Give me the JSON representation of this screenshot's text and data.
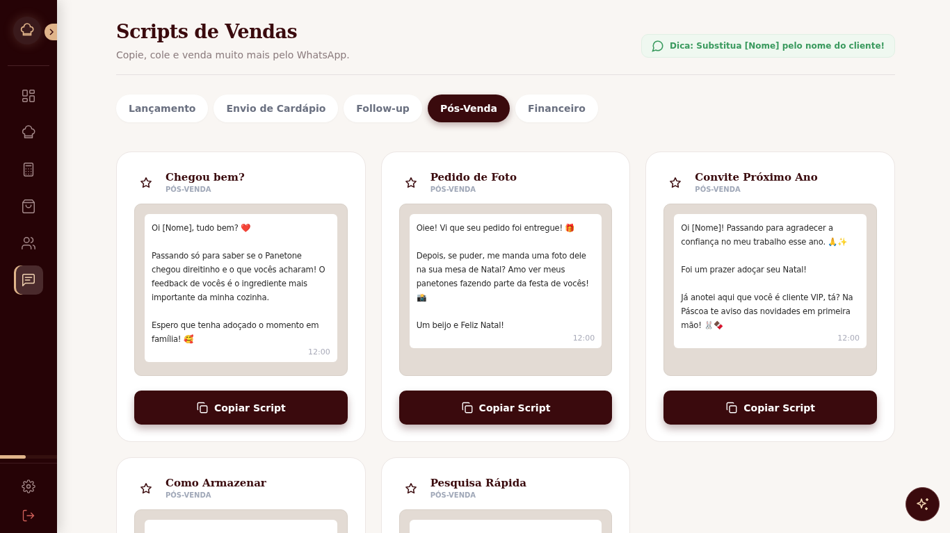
{
  "sidebar": {
    "items": [
      {
        "kind": "dashboard",
        "selected": false
      },
      {
        "kind": "chef",
        "selected": false
      },
      {
        "kind": "calculator",
        "selected": false
      },
      {
        "kind": "bag",
        "selected": false
      },
      {
        "kind": "users",
        "selected": false
      },
      {
        "kind": "chat",
        "selected": true
      }
    ],
    "progress": {
      "level": 0.45
    }
  },
  "header": {
    "title": "Scripts de Vendas",
    "subtitle": "Copie, cole e venda muito mais pelo WhatsApp.",
    "tip": "Dica: Substitua [Nome] pelo nome do cliente!"
  },
  "tabs": [
    {
      "label": "Lançamento",
      "selected": false
    },
    {
      "label": "Envio de Cardápio",
      "selected": false
    },
    {
      "label": "Follow-up",
      "selected": false
    },
    {
      "label": "Pós-Venda",
      "selected": true
    },
    {
      "label": "Financeiro",
      "selected": false
    }
  ],
  "cards": [
    {
      "title": "Chegou bem?",
      "category": "PÓS-VENDA",
      "message": "Oi [Nome], tudo bem? ❤️\n\nPassando só para saber se o Panetone chegou direitinho e o que vocês acharam! O feedback de vocês é o ingrediente mais importante da minha cozinha.\n\nEspero que tenha adoçado o momento em família! 🥰",
      "time": "12:00",
      "button": "Copiar Script"
    },
    {
      "title": "Pedido de Foto",
      "category": "PÓS-VENDA",
      "message": "Oiee! Vi que seu pedido foi entregue! 🎁\n\nDepois, se puder, me manda uma foto dele na sua mesa de Natal? Amo ver meus panetones fazendo parte da festa de vocês! 📸\n\nUm beijo e Feliz Natal!",
      "time": "12:00",
      "button": "Copiar Script"
    },
    {
      "title": "Convite Próximo Ano",
      "category": "PÓS-VENDA",
      "message": "Oi [Nome]! Passando para agradecer a confiança no meu trabalho esse ano. 🙏✨\n\nFoi um prazer adoçar seu Natal!\n\nJá anotei aqui que você é cliente VIP, tá? Na Páscoa te aviso das novidades em primeira mão! 🐰🍫",
      "time": "12:00",
      "button": "Copiar Script"
    },
    {
      "title": "Como Armazenar",
      "category": "PÓS-VENDA"
    },
    {
      "title": "Pesquisa Rápida",
      "category": "PÓS-VENDA"
    }
  ]
}
